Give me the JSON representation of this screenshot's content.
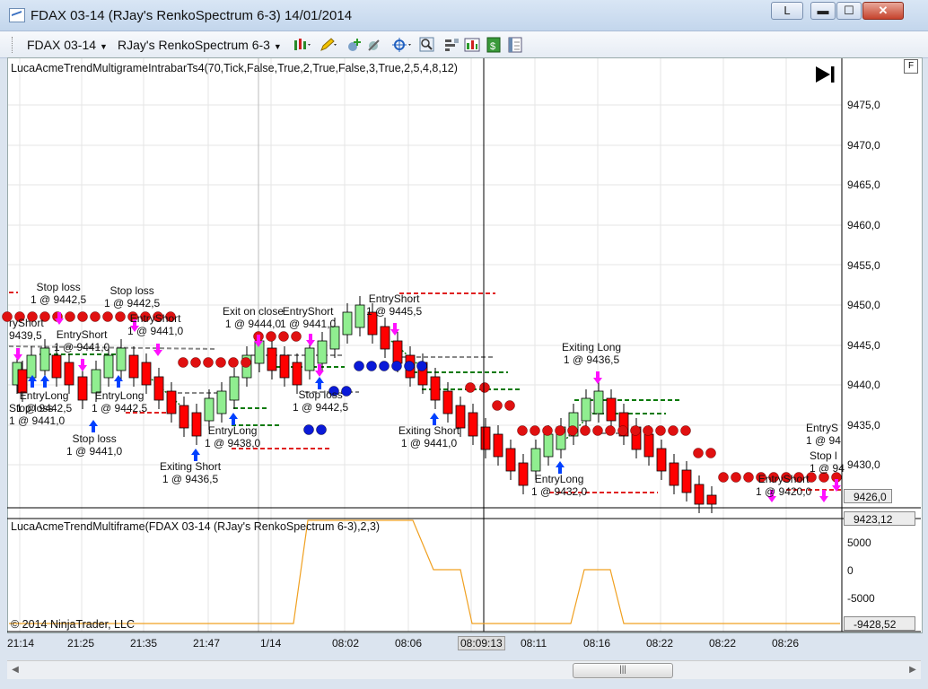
{
  "window": {
    "title": "FDAX 03-14 (RJay's RenkoSpectrum 6-3)  14/01/2014",
    "btn_l": "L",
    "btn_min": "▬",
    "btn_max": "☐",
    "btn_close": "✕"
  },
  "toolbar": {
    "instrument": "FDAX 03-14",
    "bartype": "RJay's RenkoSpectrum 6-3",
    "icons": [
      "bars-style-icon",
      "draw-pencil-icon",
      "add-indicator-icon",
      "strategy-icon",
      "crosshair-icon",
      "zoom-icon",
      "properties-icon",
      "data-box-icon",
      "save-icon",
      "chart-trader-icon"
    ]
  },
  "chart": {
    "indicator_top": "LucaAcmeTrendMultigrameIntrabarTs4(70,Tick,False,True,2,True,False,3,True,2,5,4,8,12)",
    "indicator_bottom": "LucaAcmeTrendMultiframe(FDAX  03-14  (RJay's  RenkoSpectrum  6-3),2,3)",
    "copyright": "© 2014 NinjaTrader, LLC",
    "f_button": "F",
    "price_labels": [
      "9475,0",
      "9470,0",
      "9465,0",
      "9460,0",
      "9455,0",
      "9450,0",
      "9445,0",
      "9440,0",
      "9435,0",
      "9430,0"
    ],
    "last_price": "9426,0",
    "indicator_value": "9423,12",
    "osc_labels": [
      "5000",
      "0",
      "-5000"
    ],
    "osc_value": "-9428,52",
    "time_labels": [
      "21:14",
      "21:25",
      "21:35",
      "21:47",
      "1/14",
      "08:02",
      "08:06",
      "08:09:13",
      "08:11",
      "08:16",
      "08:22",
      "08:22",
      "08:26"
    ],
    "annotations": [
      {
        "l1": "Stop loss",
        "l2": "1 @ 9442,5"
      },
      {
        "l1": "Stop loss",
        "l2": "1 @ 9442,5"
      },
      {
        "l1": "ryShort",
        "l2": "9439,5"
      },
      {
        "l1": "EntryShort",
        "l2": "1 @ 9441,0"
      },
      {
        "l1": "EntryShort",
        "l2": "1 @ 9441,0"
      },
      {
        "l1": "EntryLong",
        "l2": "1 @ 9442,5"
      },
      {
        "l1": "EntryLong",
        "l2": "1 @ 9442,5"
      },
      {
        "l1": "Stop loss",
        "l2": "1 @ 9441,0"
      },
      {
        "l1": "Stop loss",
        "l2": "1 @ 9441,0"
      },
      {
        "l1": "Exiting Short",
        "l2": "1 @ 9436,5"
      },
      {
        "l1": "EntryLong",
        "l2": "1 @ 9438,0"
      },
      {
        "l1": "Exit on close",
        "l2": "1 @ 9444,0"
      },
      {
        "l1": "EntryShort",
        "l2": "1 @ 9441,0"
      },
      {
        "l1": "Stop loss",
        "l2": "1 @ 9442,5"
      },
      {
        "l1": "EntryShort",
        "l2": "1 @ 9445,5"
      },
      {
        "l1": "Exiting Short",
        "l2": "1 @ 9441,0"
      },
      {
        "l1": "Exiting Long",
        "l2": "1 @ 9436,5"
      },
      {
        "l1": "EntryLong",
        "l2": "1 @ 9432,0"
      },
      {
        "l1": "EntryShort",
        "l2": "1 @ 9420,0"
      },
      {
        "l1": "EntryS",
        "l2": "1 @ 94"
      },
      {
        "l1": "Stop l",
        "l2": "1 @ 94"
      }
    ]
  },
  "colors": {
    "up_bar": "#90ee90",
    "down_bar": "#ff0000",
    "dot_red": "#e01010",
    "dot_blue": "#0a1ad8",
    "long_arrow": "#0040ff",
    "short_arrow": "#ff10ff",
    "oscillator": "#f0a020"
  }
}
